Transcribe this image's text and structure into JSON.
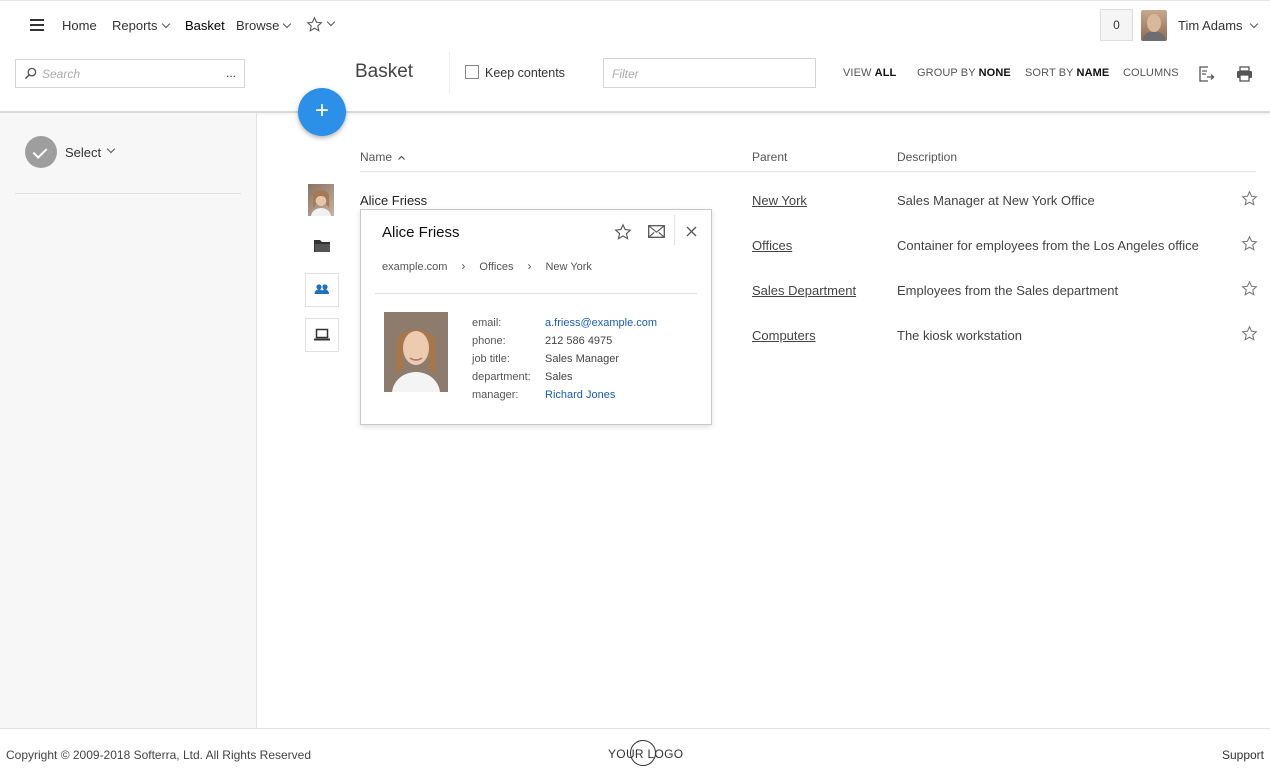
{
  "nav": {
    "home": "Home",
    "reports": "Reports",
    "basket": "Basket",
    "browse": "Browse",
    "counter": "0",
    "user_name": "Tim Adams"
  },
  "toolbar": {
    "search_placeholder": "Search",
    "search_more": "...",
    "page_title": "Basket",
    "keep_contents": "Keep contents",
    "filter_placeholder": "Filter",
    "view_prefix": "VIEW",
    "view_value": "ALL",
    "group_prefix": "GROUP BY",
    "group_value": "NONE",
    "sort_prefix": "SORT BY",
    "sort_value": "NAME",
    "columns": "COLUMNS"
  },
  "fab": {
    "label": "+"
  },
  "sidebar": {
    "select_label": "Select"
  },
  "table": {
    "headers": {
      "name": "Name",
      "parent": "Parent",
      "description": "Description"
    },
    "rows": [
      {
        "name": "Alice Friess",
        "icon": "user-photo-icon",
        "parent": "New York",
        "description": "Sales Manager at New York Office"
      },
      {
        "name": "",
        "icon": "folder-icon",
        "parent": "Offices",
        "description": "Container for employees from the Los Angeles office"
      },
      {
        "name": "",
        "icon": "group-icon",
        "parent": "Sales Department",
        "description": "Employees from the Sales department"
      },
      {
        "name": "",
        "icon": "computer-icon",
        "parent": "Computers",
        "description": "The kiosk workstation"
      }
    ]
  },
  "card": {
    "title": "Alice Friess",
    "breadcrumb": [
      "example.com",
      "Offices",
      "New York"
    ],
    "fields": {
      "email_label": "email:",
      "email_value": "a.friess@example.com",
      "phone_label": "phone:",
      "phone_value": "212 586 4975",
      "job_label": "job title:",
      "job_value": "Sales Manager",
      "dept_label": "department:",
      "dept_value": "Sales",
      "manager_label": "manager:",
      "manager_value": "Richard Jones"
    }
  },
  "footer": {
    "copyright": "Copyright © 2009-2018 Softerra, Ltd. All Rights Reserved",
    "logo": "YOUR LOGO",
    "support": "Support"
  },
  "colors": {
    "accent": "#2c8fe8",
    "link": "#1a5cb0"
  }
}
